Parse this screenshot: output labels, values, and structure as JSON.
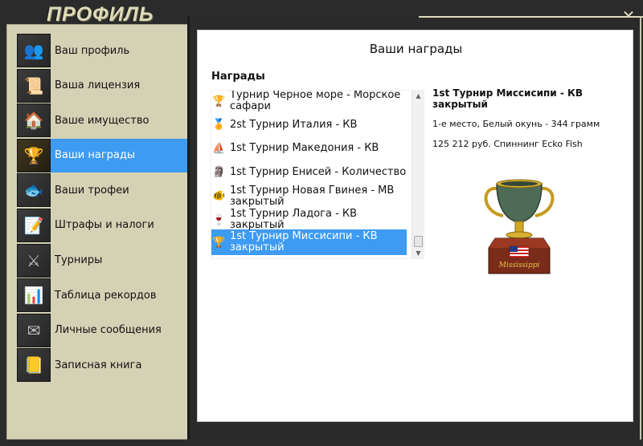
{
  "window": {
    "title": "ПРОФИЛЬ",
    "close_glyph": "✕"
  },
  "sidebar": {
    "items": [
      {
        "label": "Ваш профиль",
        "icon": "people-icon",
        "glyph": "👥",
        "active": false
      },
      {
        "label": "Ваша лицензия",
        "icon": "license-document-icon",
        "glyph": "📜",
        "active": false
      },
      {
        "label": "Ваше имущество",
        "icon": "house-icon",
        "glyph": "🏠",
        "active": false
      },
      {
        "label": "Ваши награды",
        "icon": "trophy-icon",
        "glyph": "🏆",
        "active": true
      },
      {
        "label": "Ваши трофеи",
        "icon": "fish-trophy-icon",
        "glyph": "🐟",
        "active": false
      },
      {
        "label": "Штрафы и налоги",
        "icon": "fines-document-icon",
        "glyph": "📝",
        "active": false
      },
      {
        "label": "Турниры",
        "icon": "tournament-shield-icon",
        "glyph": "⚔",
        "active": false
      },
      {
        "label": "Таблица рекордов",
        "icon": "records-chart-icon",
        "glyph": "📊",
        "active": false
      },
      {
        "label": "Личные сообщения",
        "icon": "envelope-icon",
        "glyph": "✉",
        "active": false
      },
      {
        "label": "Записная книга",
        "icon": "notebook-icon",
        "glyph": "📒",
        "active": false
      }
    ]
  },
  "main": {
    "title": "Ваши награды",
    "awards_heading": "Награды",
    "awards": [
      {
        "text": "Турнир Чёрное море - Морское сафари",
        "icon": "cup-icon",
        "glyph": "🏆",
        "selected": false
      },
      {
        "text": "2st Турнир Италия - КВ",
        "icon": "figure-award-icon",
        "glyph": "🏅",
        "selected": false
      },
      {
        "text": "1st Турнир Македония - КВ",
        "icon": "ship-award-icon",
        "glyph": "⛵",
        "selected": false
      },
      {
        "text": "1st Турнир Енисей - Количество",
        "icon": "statue-award-icon",
        "glyph": "🗿",
        "selected": false
      },
      {
        "text": "1st Турнир Новая Гвинея - МВ закрытый",
        "icon": "fish-award-icon",
        "glyph": "🐠",
        "selected": false
      },
      {
        "text": "1st Турнир Ладога - КВ закрытый",
        "icon": "goblet-award-icon",
        "glyph": "🍷",
        "selected": false
      },
      {
        "text": "1st Турнир Миссисипи - КВ закрытый",
        "icon": "cup-award-icon",
        "glyph": "🏆",
        "selected": true
      }
    ],
    "detail": {
      "title": "1st Турнир Миссисипи - КВ закрытый",
      "place": "1-е место, Белый окунь - 344 грамм",
      "prize": "125 212 руб. Спиннинг Ecko Fish",
      "trophy_plaque": "Mississippi"
    }
  }
}
